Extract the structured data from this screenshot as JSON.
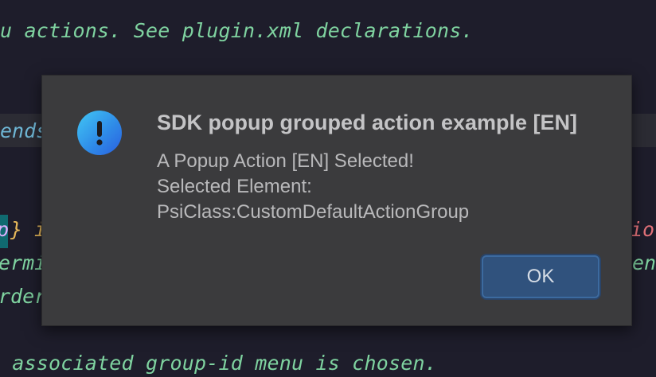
{
  "editor": {
    "line1": "u actions. See plugin.xml declarations.",
    "line2": "ends",
    "line3a": "p",
    "line3b": "}",
    "line3c": " i",
    "line3d": "io",
    "line4a": "ermi",
    "line4b": "en",
    "line5": "rder",
    "line6": " associated group-id menu is chosen."
  },
  "dialog": {
    "title": "SDK popup grouped action example [EN]",
    "message_lines": [
      "A Popup Action [EN] Selected!",
      "Selected Element:",
      "PsiClass:CustomDefaultActionGroup"
    ],
    "ok_label": "OK",
    "icon": "info-exclamation-icon"
  }
}
